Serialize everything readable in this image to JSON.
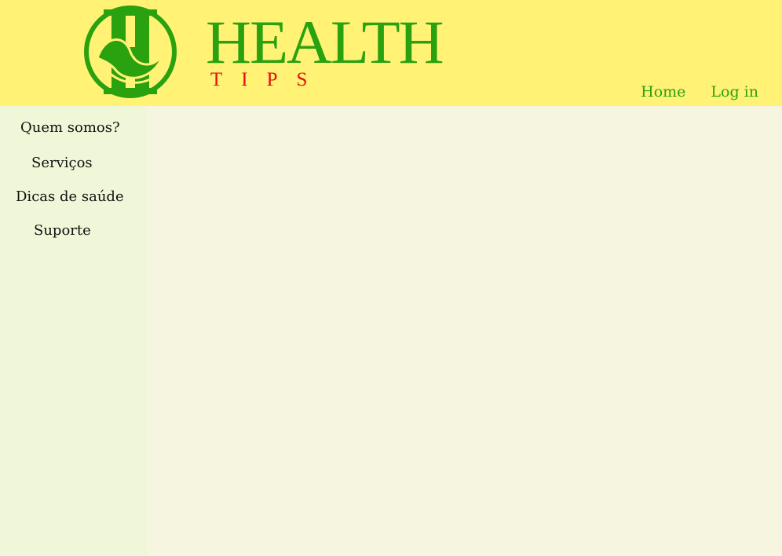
{
  "header": {
    "brand_title": "HEALTH",
    "brand_subtitle": "TIPS",
    "logo_icon": "health-h-leaf-logo"
  },
  "topnav": {
    "home_label": "Home",
    "login_label": "Log in"
  },
  "sidebar": {
    "items": [
      {
        "label": "Quem somos?"
      },
      {
        "label": "Serviços"
      },
      {
        "label": "Dicas de saúde"
      },
      {
        "label": "Suporte"
      }
    ]
  },
  "colors": {
    "header_bg": "#fff275",
    "sidebar_bg": "#eff7d8",
    "main_bg": "#f6f5df",
    "brand_green": "#2aa10f",
    "brand_red": "#e01010"
  }
}
